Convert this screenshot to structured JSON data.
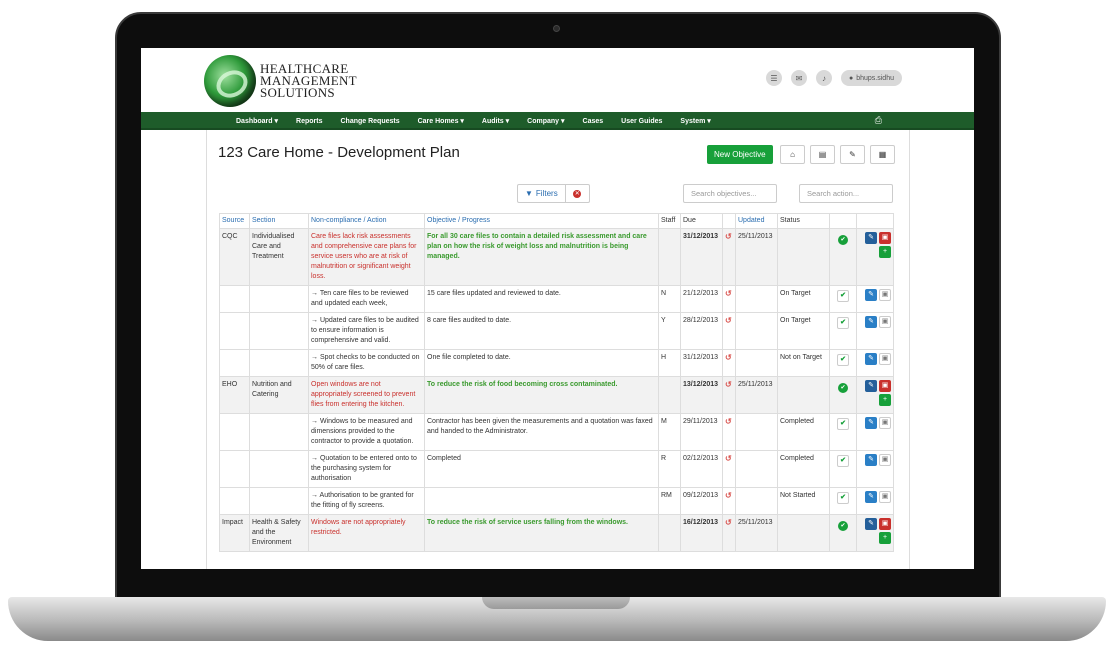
{
  "brand": {
    "line1": "HEALTHCARE",
    "line2": "MANAGEMENT",
    "line3": "SOLUTIONS"
  },
  "user": {
    "name": "bhups.sidhu"
  },
  "nav": {
    "items": [
      "Dashboard ▾",
      "Reports",
      "Change Requests",
      "Care Homes ▾",
      "Audits ▾",
      "Company ▾",
      "Cases",
      "User Guides",
      "System ▾"
    ]
  },
  "page": {
    "title": "123 Care Home - Development Plan",
    "new_objective": "New Objective"
  },
  "filters": {
    "label": "Filters",
    "search_objectives": "Search objectives...",
    "search_action": "Search action..."
  },
  "table": {
    "headers": [
      "Source",
      "Section",
      "Non-compliance / Action",
      "Objective / Progress",
      "Staff",
      "Due",
      "",
      "Updated",
      "Status"
    ],
    "rows": [
      {
        "kind": "objective",
        "source": "CQC",
        "section": "Individualised Care and Treatment",
        "noncompliance": "Care files lack risk assessments and comprehensive care plans for service users who are at risk of malnutrition or significant weight loss.",
        "objective": "For all 30 care files to contain a detailed risk assessment and care plan on how the risk of weight loss and malnutrition is being managed.",
        "staff": "",
        "due": "31/12/2013",
        "updated": "25/11/2013",
        "status": ""
      },
      {
        "kind": "action",
        "source": "",
        "section": "",
        "noncompliance": "→ Ten care files to be reviewed and updated each week,",
        "objective": "15 care files updated and reviewed to date.",
        "staff": "N",
        "due": "21/12/2013",
        "updated": "",
        "status": "On Target"
      },
      {
        "kind": "action",
        "source": "",
        "section": "",
        "noncompliance": "→ Updated care files to be audited to ensure information is comprehensive and valid.",
        "objective": "8 care files audited to date.",
        "staff": "Y",
        "due": "28/12/2013",
        "updated": "",
        "status": "On Target"
      },
      {
        "kind": "action",
        "source": "",
        "section": "",
        "noncompliance": "→ Spot checks to be conducted on 50% of care files.",
        "objective": "One file completed to date.",
        "staff": "H",
        "due": "31/12/2013",
        "updated": "",
        "status": "Not on Target"
      },
      {
        "kind": "objective",
        "source": "EHO",
        "section": "Nutrition and Catering",
        "noncompliance": "Open windows are not appropriately screened to prevent flies from entering the kitchen.",
        "objective": "To reduce the risk of food becoming cross contaminated.",
        "staff": "",
        "due": "13/12/2013",
        "updated": "25/11/2013",
        "status": ""
      },
      {
        "kind": "action",
        "source": "",
        "section": "",
        "noncompliance": "→ Windows to be measured and dimensions provided to the contractor to provide a quotation.",
        "objective": "Contractor has been given the measurements and a quotation was faxed and handed to the Administrator.",
        "staff": "M",
        "due": "29/11/2013",
        "updated": "",
        "status": "Completed"
      },
      {
        "kind": "action",
        "source": "",
        "section": "",
        "noncompliance": "→ Quotation to be entered onto to the purchasing system for authorisation",
        "objective": "Completed",
        "staff": "R",
        "due": "02/12/2013",
        "updated": "",
        "status": "Completed"
      },
      {
        "kind": "action",
        "source": "",
        "section": "",
        "noncompliance": "→ Authorisation to be granted for the fitting of fly screens.",
        "objective": "",
        "staff": "RM",
        "due": "09/12/2013",
        "updated": "",
        "status": "Not Started"
      },
      {
        "kind": "objective",
        "source": "Impact",
        "section": "Health & Safety and the Environment",
        "noncompliance": "Windows are not appropriately restricted.",
        "objective": "To reduce the risk of service users falling from the windows.",
        "staff": "",
        "due": "16/12/2013",
        "updated": "25/11/2013",
        "status": ""
      }
    ]
  }
}
